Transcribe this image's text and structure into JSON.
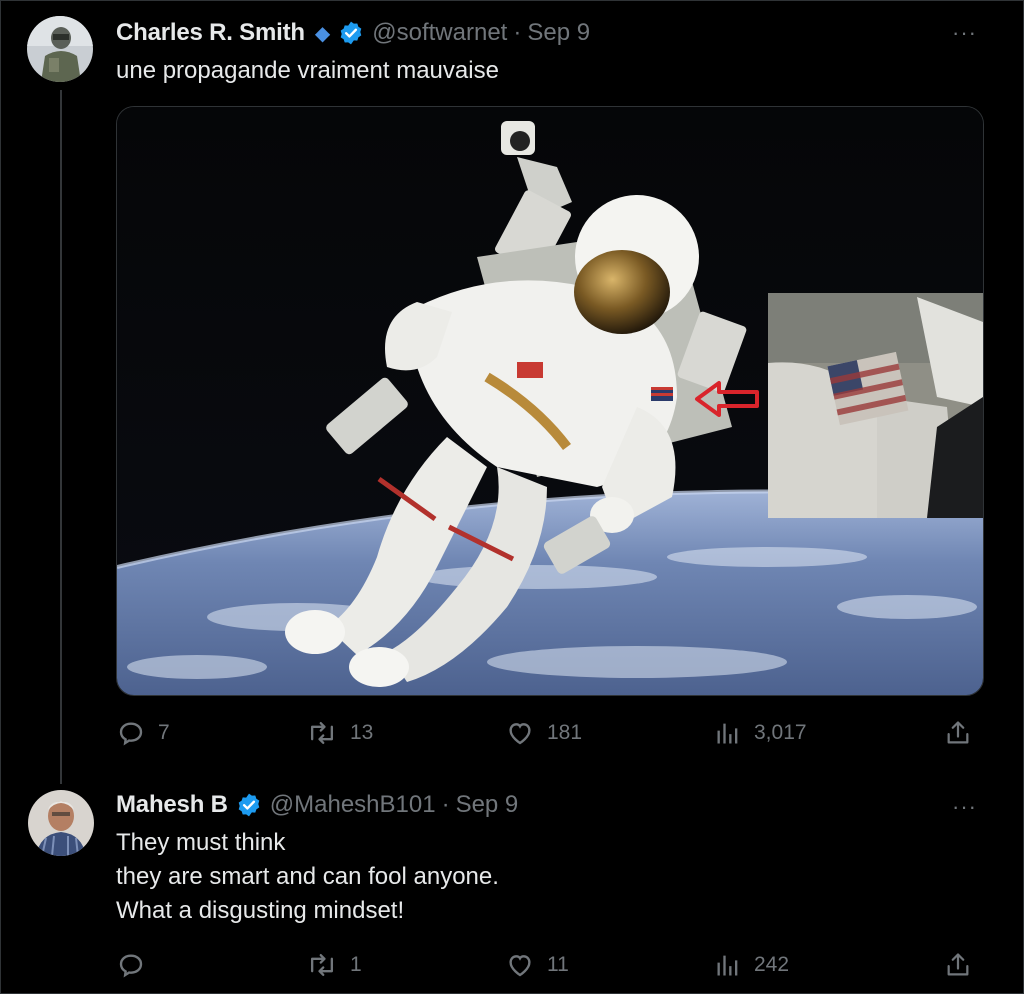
{
  "tweets": [
    {
      "author": "Charles R. Smith",
      "author_badge": "◆",
      "handle": "@softwarnet",
      "separator": "·",
      "date": "Sep 9",
      "text_lines": [
        "une propagande vraiment mauvaise"
      ],
      "metrics": {
        "replies": "7",
        "retweets": "13",
        "likes": "181",
        "views": "3,017"
      },
      "has_media": true
    },
    {
      "author": "Mahesh B",
      "handle": "@MaheshB101",
      "separator": "·",
      "date": "Sep 9",
      "text_lines": [
        "They must think",
        "they are smart and can fool anyone.",
        "What a disgusting mindset!"
      ],
      "metrics": {
        "replies": "",
        "retweets": "1",
        "likes": "11",
        "views": "242"
      },
      "has_media": false
    }
  ],
  "more_label": "···",
  "colors": {
    "background": "#000000",
    "text": "#e7e9ea",
    "muted": "#71767b",
    "verified": "#1d9bf0",
    "annotation_arrow": "#d9242b"
  },
  "icons": [
    "reply-icon",
    "retweet-icon",
    "like-icon",
    "views-icon",
    "share-icon",
    "verified-badge-icon",
    "diamond-icon",
    "more-icon"
  ]
}
